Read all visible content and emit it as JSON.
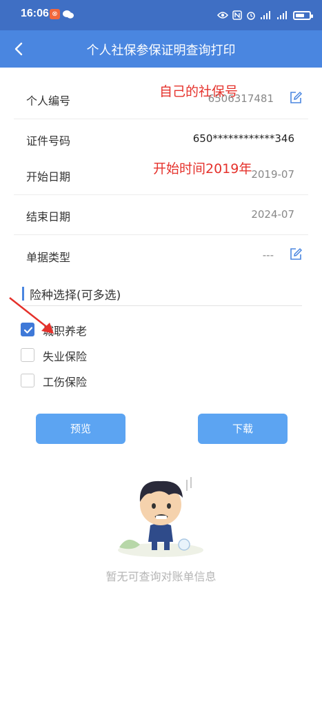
{
  "status_bar": {
    "time": "16:06",
    "app_badge": "?"
  },
  "nav": {
    "title": "个人社保参保证明查询打印"
  },
  "fields": {
    "personal_id": {
      "label": "个人编号",
      "value": "6506317481"
    },
    "id_number": {
      "label": "证件号码",
      "value": "650************346"
    },
    "start_date": {
      "label": "开始日期",
      "value": "2019-07"
    },
    "end_date": {
      "label": "结束日期",
      "value": "2024-07"
    },
    "doc_type": {
      "label": "单据类型",
      "value": "---"
    }
  },
  "annotations": {
    "own_social_security": "自己的社保号",
    "start_time_note": "开始时间2019年"
  },
  "insurance": {
    "section_title": "险种选择(可多选)",
    "options": [
      {
        "label": "城职养老",
        "checked": true
      },
      {
        "label": "失业保险",
        "checked": false
      },
      {
        "label": "工伤保险",
        "checked": false
      }
    ]
  },
  "actions": {
    "preview_label": "预览",
    "download_label": "下载"
  },
  "empty_state": {
    "message": "暂无可查询对账单信息"
  },
  "colors": {
    "header_blue": "#4a86e0",
    "status_blue": "#3f6fc4",
    "button_blue": "#5ca4f2",
    "annotation_red": "#e5312b"
  }
}
